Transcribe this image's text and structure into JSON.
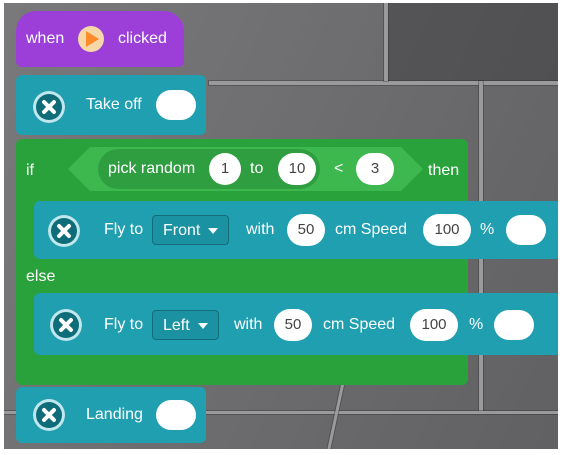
{
  "event": {
    "when": "when",
    "clicked": "clicked",
    "icon": "green-flag-icon"
  },
  "takeoff": {
    "label": "Take off",
    "icon": "drone-icon"
  },
  "if_block": {
    "if": "if",
    "then": "then",
    "else": "else",
    "condition": {
      "pick_random": "pick random",
      "from": "1",
      "to_label": "to",
      "to": "10",
      "operator": "<",
      "compare": "3"
    }
  },
  "fly1": {
    "label": "Fly to",
    "direction": "Front",
    "with": "with",
    "distance": "50",
    "cm_speed": "cm Speed",
    "speed": "100",
    "percent": "%"
  },
  "fly2": {
    "label": "Fly to",
    "direction": "Left",
    "with": "with",
    "distance": "50",
    "cm_speed": "cm Speed",
    "speed": "100",
    "percent": "%"
  },
  "landing": {
    "label": "Landing",
    "icon": "drone-icon"
  },
  "colors": {
    "event": "#9b3fd8",
    "drone": "#1f9fb0",
    "control": "#2aa23b"
  }
}
